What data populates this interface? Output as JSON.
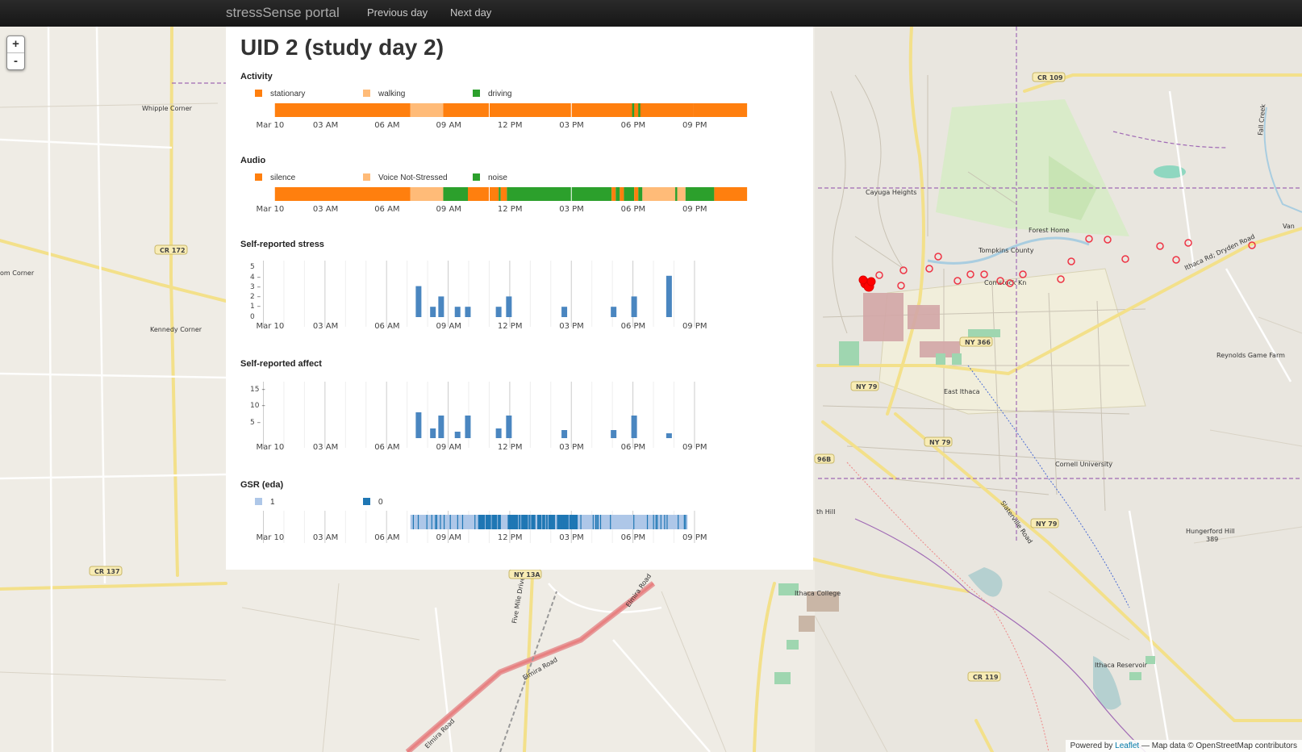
{
  "nav": {
    "brand": "stressSense portal",
    "prev": "Previous day",
    "next": "Next day"
  },
  "page": {
    "title": "UID 2 (study day 2)"
  },
  "map": {
    "zoom_in": "+",
    "zoom_out": "-",
    "attribution_prefix": "Powered by ",
    "attribution_link": "Leaflet",
    "attribution_suffix": " — Map data © OpenStreetMap contributors",
    "labels": {
      "whipple": "Whipple Corner",
      "kennedy": "Kennedy Corner",
      "corner_left": "om Corner",
      "cayuga": "Cayuga Heights",
      "forest": "Forest Home",
      "tompkins": "Tompkins County",
      "comstock": "Comstock Kn",
      "reynolds": "Reynolds Game Farm",
      "east_ithaca": "East Ithaca",
      "cornell": "Cornell University",
      "hungerford": "Hungerford Hill",
      "hungerford_elev": "389",
      "ithaca_college": "Ithaca College",
      "reservoir": "Ithaca Reservoir",
      "fivemile": "Five Mile Drive",
      "elmira1": "Elmira Road",
      "elmira2": "Elmira Road",
      "elmira3": "Elmira Road",
      "slaterville": "Slaterville Road",
      "dryden": "Ithaca Rd; Dryden Road",
      "south_hill": "th Hill",
      "fall_creek": "Fall Creek",
      "van": "Van"
    },
    "shields": {
      "cr109": "CR 109",
      "cr172": "CR 172",
      "cr137": "CR 137",
      "ny13a": "NY 13A",
      "ny366": "NY 366",
      "ny79a": "NY 79",
      "ny79b": "NY 79",
      "ny79c": "NY 79",
      "r96b": "96B",
      "cr119": "CR 119"
    },
    "marker_color": "#ff0000"
  },
  "axis": {
    "ticks": [
      "Mar 10",
      "03 AM",
      "06 AM",
      "09 AM",
      "12 PM",
      "03 PM",
      "06 PM",
      "09 PM"
    ],
    "hours": [
      0,
      3,
      6,
      9,
      12,
      15,
      18,
      21
    ]
  },
  "sections": {
    "activity": {
      "title": "Activity",
      "legend": [
        {
          "label": "stationary",
          "color": "#ff7f0e"
        },
        {
          "label": "walking",
          "color": "#ffbb78"
        },
        {
          "label": "driving",
          "color": "#2ca02c"
        }
      ],
      "segments": [
        {
          "start": 0.6,
          "end": 7.2,
          "cat": 0
        },
        {
          "start": 7.2,
          "end": 8.8,
          "cat": 1
        },
        {
          "start": 8.8,
          "end": 21.0,
          "cat": 0
        },
        {
          "start": 18.0,
          "end": 18.1,
          "cat": 2
        },
        {
          "start": 18.3,
          "end": 18.4,
          "cat": 2
        },
        {
          "start": 21.0,
          "end": 23.6,
          "cat": 0
        }
      ]
    },
    "audio": {
      "title": "Audio",
      "legend": [
        {
          "label": "silence",
          "color": "#ff7f0e"
        },
        {
          "label": "Voice Not-Stressed",
          "color": "#ffbb78"
        },
        {
          "label": "noise",
          "color": "#2ca02c"
        }
      ],
      "segments": [
        {
          "start": 0.6,
          "end": 7.2,
          "cat": 0
        },
        {
          "start": 7.2,
          "end": 8.8,
          "cat": 1
        },
        {
          "start": 8.8,
          "end": 10.0,
          "cat": 2
        },
        {
          "start": 10.0,
          "end": 11.5,
          "cat": 0
        },
        {
          "start": 11.5,
          "end": 11.6,
          "cat": 2
        },
        {
          "start": 11.6,
          "end": 11.9,
          "cat": 0
        },
        {
          "start": 11.9,
          "end": 17.0,
          "cat": 2
        },
        {
          "start": 17.0,
          "end": 17.2,
          "cat": 0
        },
        {
          "start": 17.2,
          "end": 17.4,
          "cat": 2
        },
        {
          "start": 17.4,
          "end": 17.6,
          "cat": 0
        },
        {
          "start": 17.6,
          "end": 18.1,
          "cat": 2
        },
        {
          "start": 18.1,
          "end": 18.3,
          "cat": 0
        },
        {
          "start": 18.3,
          "end": 18.5,
          "cat": 2
        },
        {
          "start": 18.5,
          "end": 20.1,
          "cat": 1
        },
        {
          "start": 20.1,
          "end": 20.2,
          "cat": 2
        },
        {
          "start": 20.2,
          "end": 20.6,
          "cat": 1
        },
        {
          "start": 20.6,
          "end": 22.0,
          "cat": 2
        },
        {
          "start": 22.0,
          "end": 23.6,
          "cat": 0
        }
      ]
    },
    "stress": {
      "title": "Self-reported stress",
      "yticks": [
        "5",
        "4 –",
        "3 –",
        "2 –",
        "1 –",
        "0"
      ],
      "ymax": 5,
      "bar_color": "#4a86c0",
      "bars": [
        {
          "t": 7.5,
          "v": 3
        },
        {
          "t": 8.2,
          "v": 1
        },
        {
          "t": 8.6,
          "v": 2
        },
        {
          "t": 9.4,
          "v": 1
        },
        {
          "t": 9.9,
          "v": 1
        },
        {
          "t": 11.4,
          "v": 1
        },
        {
          "t": 11.9,
          "v": 2
        },
        {
          "t": 14.6,
          "v": 1
        },
        {
          "t": 17.0,
          "v": 1
        },
        {
          "t": 18.0,
          "v": 2
        },
        {
          "t": 19.7,
          "v": 4
        }
      ]
    },
    "affect": {
      "title": "Self-reported affect",
      "yticks": [
        "15 –",
        "10 –",
        "5 –"
      ],
      "ymax": 16,
      "bar_color": "#4a86c0",
      "bars": [
        {
          "t": 7.5,
          "v": 8
        },
        {
          "t": 8.2,
          "v": 3
        },
        {
          "t": 8.6,
          "v": 7
        },
        {
          "t": 9.4,
          "v": 2
        },
        {
          "t": 9.9,
          "v": 7
        },
        {
          "t": 11.4,
          "v": 3
        },
        {
          "t": 11.9,
          "v": 7
        },
        {
          "t": 14.6,
          "v": 2.5
        },
        {
          "t": 17.0,
          "v": 2.5
        },
        {
          "t": 18.0,
          "v": 7
        },
        {
          "t": 19.7,
          "v": 1.5
        }
      ]
    },
    "gsr": {
      "title": "GSR (eda)",
      "legend": [
        {
          "label": "1",
          "color": "#aec7e8"
        },
        {
          "label": "0",
          "color": "#1f77b4"
        }
      ],
      "start": 7.2,
      "end": 20.7,
      "dense_start": 10.5,
      "dense_end": 15.3
    }
  },
  "chart_data": [
    {
      "type": "bar",
      "title": "Self-reported stress",
      "x": [
        "07:30",
        "08:12",
        "08:36",
        "09:24",
        "09:54",
        "11:24",
        "11:54",
        "14:36",
        "17:00",
        "18:00",
        "19:42"
      ],
      "values": [
        3,
        1,
        2,
        1,
        1,
        1,
        2,
        1,
        1,
        2,
        4
      ],
      "ylim": [
        0,
        5
      ]
    },
    {
      "type": "bar",
      "title": "Self-reported affect",
      "x": [
        "07:30",
        "08:12",
        "08:36",
        "09:24",
        "09:54",
        "11:24",
        "11:54",
        "14:36",
        "17:00",
        "18:00",
        "19:42"
      ],
      "values": [
        8,
        3,
        7,
        2,
        7,
        3,
        7,
        2.5,
        2.5,
        7,
        1.5
      ],
      "ylim": [
        0,
        16
      ]
    }
  ]
}
